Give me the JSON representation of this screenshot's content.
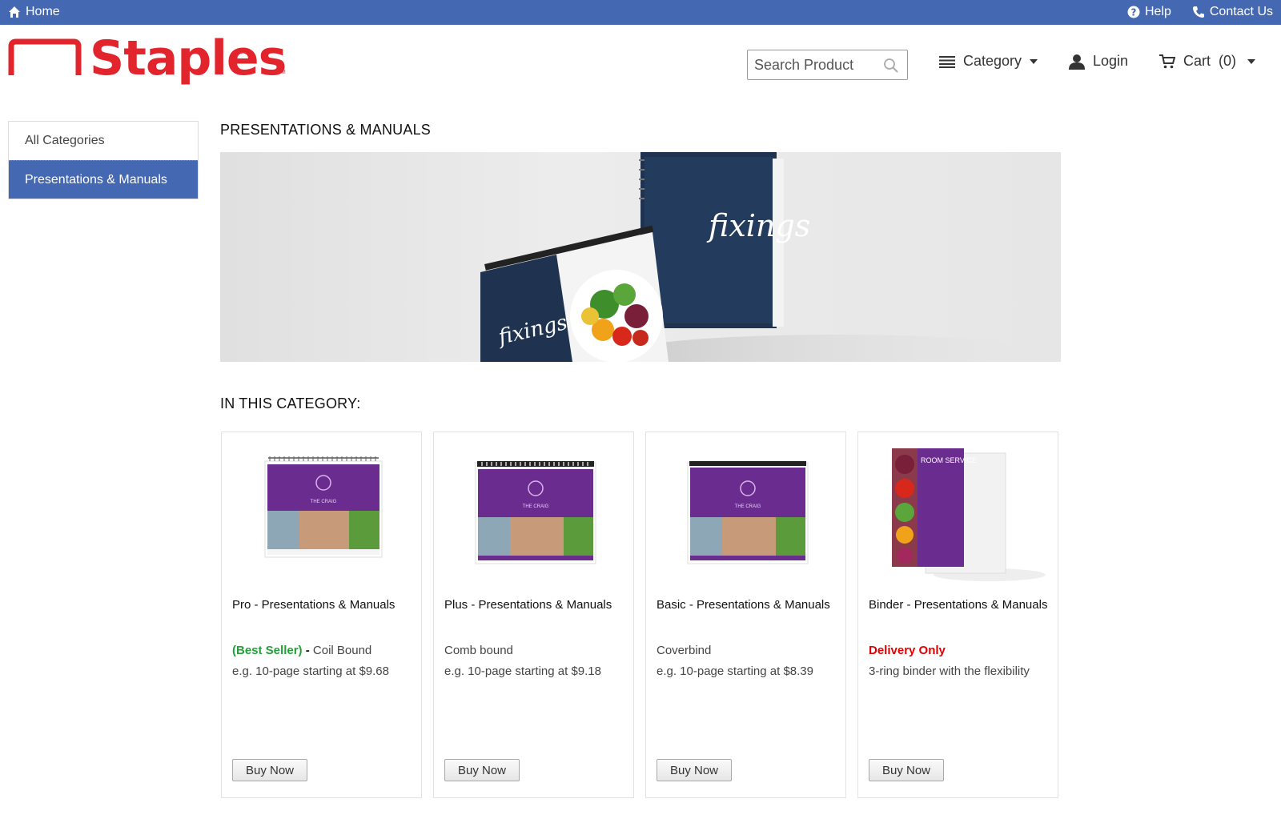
{
  "topbar": {
    "home_label": "Home",
    "help_label": "Help",
    "contact_label": "Contact Us"
  },
  "brand": {
    "name": "Staples",
    "tm": "TM",
    "color": "#e2242d"
  },
  "header": {
    "search_placeholder": "Search Product",
    "category_label": "Category",
    "login_label": "Login",
    "cart_label": "Cart",
    "cart_count": "(0)"
  },
  "sidebar": {
    "items": [
      {
        "label": "All Categories",
        "active": false
      },
      {
        "label": "Presentations & Manuals",
        "active": true
      }
    ]
  },
  "main": {
    "page_title": "PRESENTATIONS & MANUALS",
    "hero_text": "fixings",
    "section_title": "IN THIS CATEGORY:"
  },
  "products": [
    {
      "name": "Pro - Presentations & Manuals",
      "highlight": "(Best Seller)",
      "highlight_color": "#22a03a",
      "sep": " - ",
      "tag": "Coil Bound",
      "desc": "e.g. 10-page starting at $9.68",
      "button": "Buy Now",
      "thumb_title": "THE CRAIG"
    },
    {
      "name": "Plus - Presentations & Manuals",
      "highlight": "",
      "sep": "",
      "tag": "Comb bound",
      "desc": "e.g. 10-page starting at $9.18",
      "button": "Buy Now",
      "thumb_title": "THE CRAIG"
    },
    {
      "name": "Basic - Presentations & Manuals",
      "highlight": "",
      "sep": "",
      "tag": "Coverbind",
      "desc": "e.g. 10-page starting at $8.39",
      "button": "Buy Now",
      "thumb_title": "THE CRAIG"
    },
    {
      "name": "Binder - Presentations & Manuals",
      "highlight": "Delivery Only",
      "highlight_color": "#e00000",
      "sep": "",
      "tag": "",
      "desc": "3-ring binder with the flexibility",
      "button": "Buy Now",
      "thumb_title": "ROOM SERVICE"
    }
  ],
  "colors": {
    "accent": "#4568b2",
    "purple": "#6a2d8f"
  }
}
